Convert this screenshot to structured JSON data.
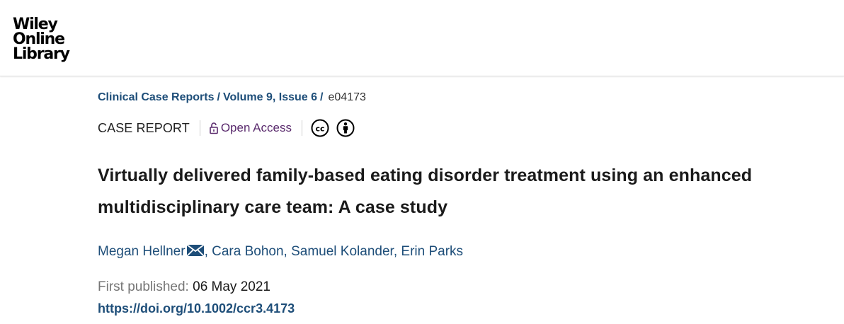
{
  "header": {
    "logo_lines": [
      "Wiley",
      "Online",
      "Library"
    ]
  },
  "breadcrumb": {
    "journal": "Clinical Case Reports",
    "volume": "Volume 9, Issue 6",
    "separator": "/",
    "article_id": "e04173"
  },
  "meta": {
    "article_type": "CASE REPORT",
    "open_access": "Open Access",
    "license_icons": [
      "cc-icon",
      "attribution-icon"
    ]
  },
  "article": {
    "title": "Virtually delivered family-based eating disorder treatment using an enhanced multidisciplinary care team: A case study",
    "authors": [
      "Megan Hellner",
      "Cara Bohon",
      "Samuel Kolander",
      "Erin Parks"
    ],
    "author_separator": ",",
    "published_label": "First published:",
    "published_date": "06 May 2021",
    "doi": "https://doi.org/10.1002/ccr3.4173"
  },
  "colors": {
    "link": "#1e4e79",
    "open_access": "#5a2a6d",
    "muted": "#767676"
  }
}
